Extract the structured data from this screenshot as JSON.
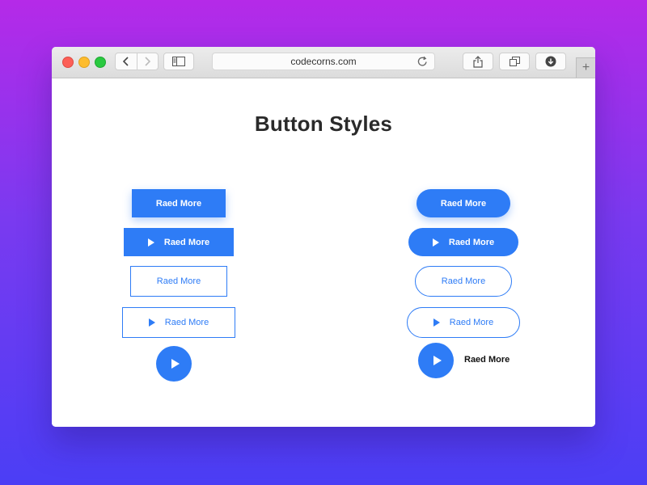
{
  "browser": {
    "url": "codecorns.com",
    "new_tab_symbol": "+"
  },
  "page": {
    "title": "Button Styles"
  },
  "buttons": {
    "left_solid": "Raed More",
    "left_solid_icon": "Raed More",
    "left_outline": "Raed More",
    "left_outline_icon": "Raed More",
    "right_solid": "Raed More",
    "right_solid_icon": "Raed More",
    "right_outline": "Raed More",
    "right_outline_icon": "Raed More",
    "right_circle_label": "Raed More"
  },
  "colors": {
    "accent": "#2e7cf6",
    "background_top": "#b52ae8",
    "background_bottom": "#4b3ef5"
  }
}
